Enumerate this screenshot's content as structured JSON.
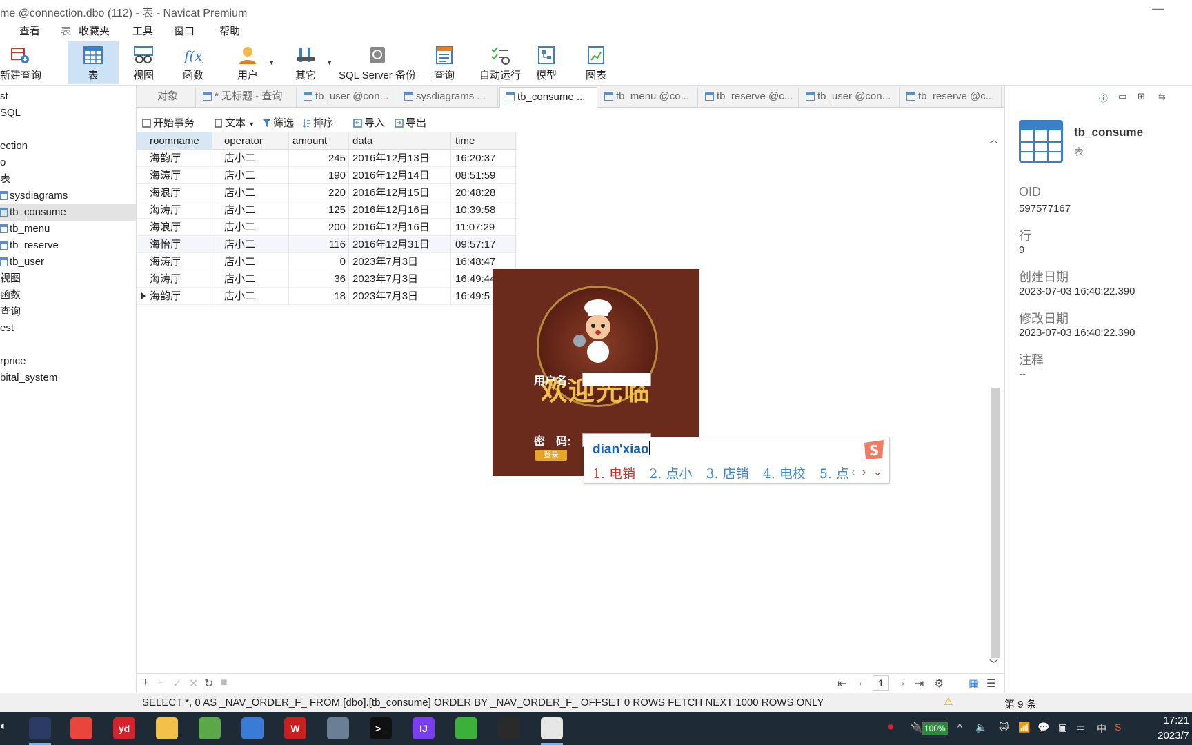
{
  "window": {
    "title": "me @connection.dbo (112) - 表 - Navicat Premium",
    "minimize_glyph": "—"
  },
  "menu": {
    "items": [
      "查看",
      "表",
      "收藏夹",
      "工具",
      "窗口",
      "帮助"
    ]
  },
  "toolbar": {
    "buttons": [
      {
        "label": "新建查询",
        "icon": "new-query-icon"
      },
      {
        "label": "表",
        "icon": "table-icon"
      },
      {
        "label": "视图",
        "icon": "view-icon"
      },
      {
        "label": "函数",
        "icon": "function-icon"
      },
      {
        "label": "用户",
        "icon": "user-icon"
      },
      {
        "label": "其它",
        "icon": "tools-icon"
      },
      {
        "label": "SQL Server 备份",
        "icon": "backup-icon"
      },
      {
        "label": "查询",
        "icon": "query-icon"
      },
      {
        "label": "自动运行",
        "icon": "automation-icon"
      },
      {
        "label": "模型",
        "icon": "model-icon"
      },
      {
        "label": "图表",
        "icon": "chart-icon"
      }
    ]
  },
  "sidebar": {
    "items": [
      "st",
      "SQL",
      "ection",
      "o",
      "表",
      "sysdiagrams",
      "tb_consume",
      "tb_menu",
      "tb_reserve",
      "tb_user",
      "视图",
      "函数",
      "查询",
      "est",
      "rprice",
      "bital_system"
    ],
    "selected": "tb_consume"
  },
  "tabs": {
    "items": [
      "对象",
      "* 无标题 - 查询",
      "tb_user @con...",
      "sysdiagrams ...",
      "tb_consume ...",
      "tb_menu @co...",
      "tb_reserve @c...",
      "tb_user @con...",
      "tb_reserve @c..."
    ],
    "active": "tb_consume ..."
  },
  "actions": {
    "begin_tx": "开始事务",
    "text": "文本",
    "filter": "筛选",
    "sort": "排序",
    "import": "导入",
    "export": "导出"
  },
  "grid": {
    "columns": [
      "roomname",
      "operator",
      "amount",
      "data",
      "time"
    ],
    "rows": [
      [
        "海韵厅",
        "店小二",
        "245",
        "2016年12月13日",
        "16:20:37"
      ],
      [
        "海涛厅",
        "店小二",
        "190",
        "2016年12月14日",
        "08:51:59"
      ],
      [
        "海浪厅",
        "店小二",
        "220",
        "2016年12月15日",
        "20:48:28"
      ],
      [
        "海涛厅",
        "店小二",
        "125",
        "2016年12月16日",
        "10:39:58"
      ],
      [
        "海浪厅",
        "店小二",
        "200",
        "2016年12月16日",
        "11:07:29"
      ],
      [
        "海怡厅",
        "店小二",
        "116",
        "2016年12月31日",
        "09:57:17"
      ],
      [
        "海涛厅",
        "店小二",
        "0",
        "2023年7月3日",
        "16:48:47"
      ],
      [
        "海涛厅",
        "店小二",
        "36",
        "2023年7月3日",
        "16:49:44"
      ],
      [
        "海韵厅",
        "店小二",
        "18",
        "2023年7月3日",
        "16:49:5"
      ]
    ]
  },
  "pager": {
    "page": "1"
  },
  "status": {
    "sql": "SELECT *, 0 AS _NAV_ORDER_F_ FROM [dbo].[tb_consume] ORDER BY _NAV_ORDER_F_ OFFSET 0 ROWS FETCH NEXT 1000 ROWS ONLY",
    "record_count": "第 9 条"
  },
  "info": {
    "name": "tb_consume",
    "type": "表",
    "fields": [
      {
        "key": "OID",
        "value": "597577167"
      },
      {
        "key": "行",
        "value": "9"
      },
      {
        "key": "创建日期",
        "value": "2023-07-03 16:40:22.390"
      },
      {
        "key": "修改日期",
        "value": "2023-07-03 16:40:22.390"
      },
      {
        "key": "注释",
        "value": "--"
      }
    ]
  },
  "login": {
    "welcome": "欢迎光临",
    "username_label": "用户名:",
    "password_label": "密　码:",
    "login_button": "登录",
    "username_value": ""
  },
  "ime": {
    "composition": "dian'xiao",
    "candidates": [
      "1. 电销",
      "2. 点小",
      "3. 店销",
      "4. 电校",
      "5. 点"
    ],
    "logo_letter": "S"
  },
  "taskbar": {
    "apps": [
      {
        "name": "visual-studio",
        "label": "",
        "color": "#2b3b66"
      },
      {
        "name": "chrome",
        "label": "",
        "color": "#e8453c"
      },
      {
        "name": "youdao",
        "label": "yd",
        "color": "#d6222a"
      },
      {
        "name": "file-explorer",
        "label": "",
        "color": "#f2c14a"
      },
      {
        "name": "notepad",
        "label": "",
        "color": "#5aa847"
      },
      {
        "name": "browser-2",
        "label": "",
        "color": "#3a7bd5"
      },
      {
        "name": "wps",
        "label": "W",
        "color": "#c8201e"
      },
      {
        "name": "rocket-app",
        "label": "",
        "color": "#6a7f95"
      },
      {
        "name": "terminal",
        "label": ">_",
        "color": "#111111"
      },
      {
        "name": "intellij",
        "label": "IJ",
        "color": "#7a3df0"
      },
      {
        "name": "wechat",
        "label": "",
        "color": "#3bb13a"
      },
      {
        "name": "loader",
        "label": "",
        "color": "#2a2a2a"
      },
      {
        "name": "java",
        "label": "",
        "color": "#e6e6e6"
      }
    ],
    "battery": "100%",
    "ime_mode": "中",
    "time": "17:21",
    "date": "2023/7"
  }
}
